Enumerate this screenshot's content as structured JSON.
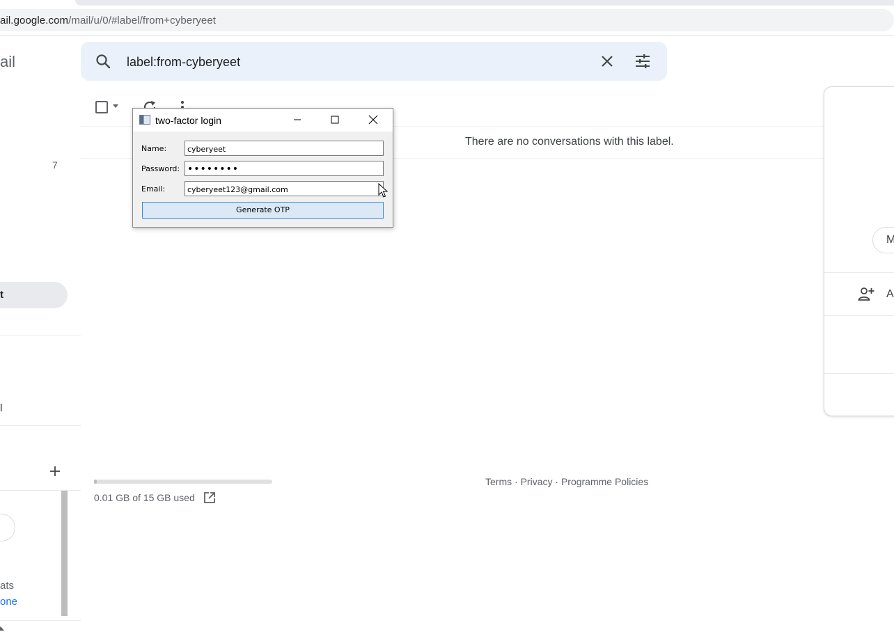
{
  "browser": {
    "url_host": "ail.google.com",
    "url_path": "/mail/u/0/#label/from+cyberyeet"
  },
  "gmail": {
    "brand_partial": "ail",
    "search": {
      "query": "label:from-cyberyeet"
    },
    "empty_message": "There are no conversations with this label.",
    "sidebar": {
      "unread_count": "7",
      "active_label_partial": "t",
      "item_partial": "l",
      "chat_partial": "ats",
      "phone_partial": "one"
    },
    "footer": {
      "storage_text": "0.01 GB of 15 GB used",
      "storage_used_fraction": 0.0007,
      "links": [
        "Terms",
        "Privacy",
        "Programme Policies"
      ],
      "link_separator": " · "
    },
    "right_panel": {
      "pill_partial": "M",
      "add_partial": "A"
    }
  },
  "dialog": {
    "title": "two-factor login",
    "fields": {
      "name_label": "Name:",
      "name_value": "cyberyeet",
      "password_label": "Password:",
      "password_value": "••••••••",
      "email_label": "Email:",
      "email_value": "cyberyeet123@gmail.com"
    },
    "button_label": "Generate OTP"
  },
  "colors": {
    "search_bg": "#eaf1fb",
    "button_bg": "#dbe9f7",
    "button_border": "#3c8cd8",
    "link_blue": "#1a73e8"
  }
}
